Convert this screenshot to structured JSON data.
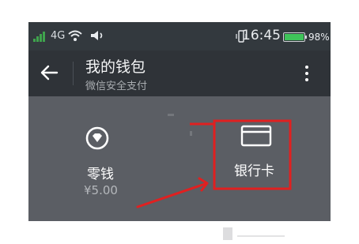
{
  "status_bar": {
    "network": "4G",
    "time": "16:45",
    "battery_percent": "98%",
    "battery_level": 0.98,
    "colors": {
      "signal": "#3fa34d",
      "battery": "#3fc45a"
    }
  },
  "title_bar": {
    "title": "我的钱包",
    "subtitle": "微信安全支付",
    "back_icon": "back-arrow-icon",
    "more_icon": "more-vertical-icon"
  },
  "wallet": {
    "change": {
      "label": "零钱",
      "amount": "¥5.00",
      "icon": "change-diamond-icon"
    },
    "bank_card": {
      "label": "银行卡",
      "icon": "bank-card-icon"
    }
  },
  "annotation": {
    "color": "#e02020"
  }
}
